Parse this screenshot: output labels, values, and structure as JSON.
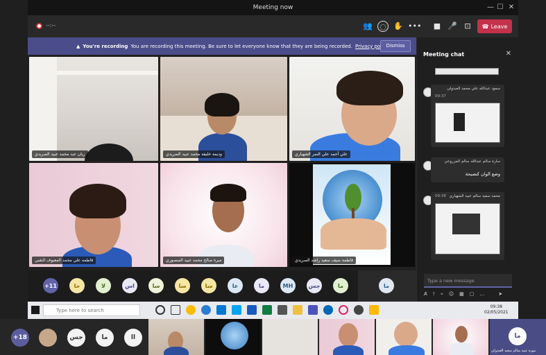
{
  "window": {
    "title": "Meeting now"
  },
  "toolbar": {
    "timer": "--:--",
    "leave_label": "Leave"
  },
  "banner": {
    "heading": "You're recording",
    "message": "You are recording this meeting. Be sure to let everyone know that they are being recorded.",
    "link": "Privacy policy",
    "dismiss_label": "Dismiss"
  },
  "tiles": [
    {
      "name": "ريان عبد محمد عبيد الصريدي"
    },
    {
      "name": "وديمة خليفة محمد عبيد الضريدي"
    },
    {
      "name": "علي أحمد علي النمر الشهياري"
    },
    {
      "name": "فاطمه علي محمد المعيوف النقبي"
    },
    {
      "name": "ميرة صالح محمد عبيد المنصوري"
    },
    {
      "name": "فاطمة سيف سعيد راشد الصريدي"
    }
  ],
  "avatar_bar": {
    "overflow": "+11",
    "items": [
      "حا",
      "لا",
      "اس",
      "سا",
      "سا",
      "سا",
      "عا",
      "ما",
      "MH",
      "جس",
      "ما"
    ],
    "self": "ما"
  },
  "chat": {
    "title": "Meeting chat",
    "messages": [
      {
        "sender": "سعود عبدالله علي محمد العبدولي",
        "time": "09:37",
        "text": ""
      },
      {
        "sender": "سارة سالم عبدالله سالم المزروعي",
        "time": "",
        "text": "وضع الوان كنصيحة"
      },
      {
        "sender": "محمد سعيد سالم عبيد الشهياري",
        "time": "09:38",
        "text": ""
      }
    ],
    "compose_placeholder": "Type a new message"
  },
  "taskbar": {
    "search_placeholder": "Type here to search",
    "time": "09:38",
    "date": "02/05/2021"
  },
  "bottom_strip": {
    "overflow": "+18",
    "avatars": [
      "جس",
      "ما",
      "اا"
    ],
    "caption": "موزة عبيد سالم سعيد العبدولي",
    "self_initials": "ما"
  },
  "colors": {
    "banner": "#4b4c8a",
    "leave": "#c4314b",
    "accent": "#6264a7"
  }
}
